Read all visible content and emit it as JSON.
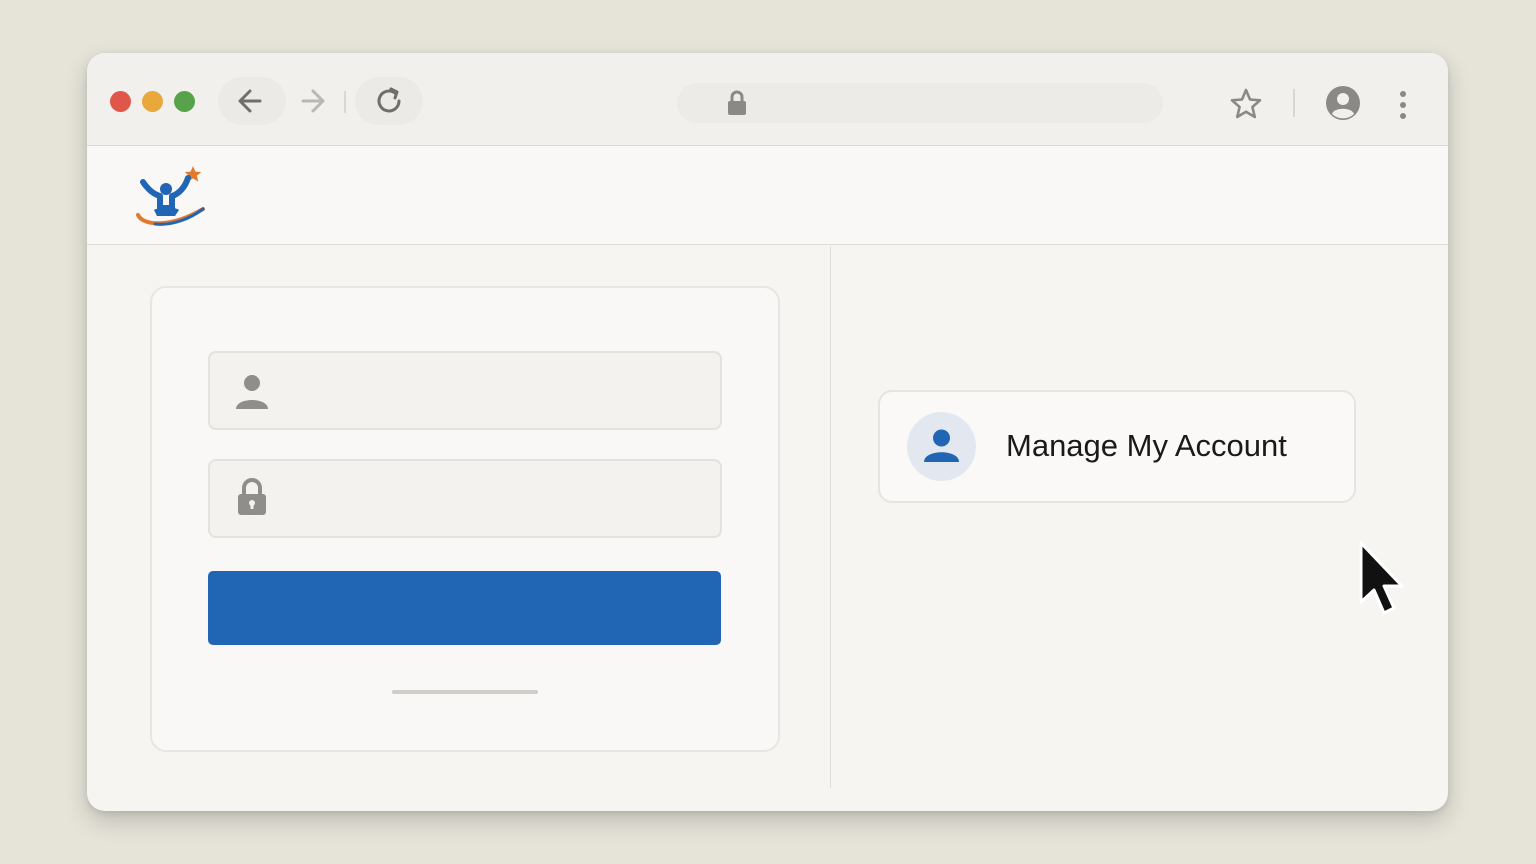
{
  "browser": {
    "traffic_lights": {
      "close_color": "#e0574a",
      "minimize_color": "#e8a93a",
      "maximize_color": "#57a34a"
    },
    "nav": {
      "back_icon": "arrow-left-icon",
      "forward_icon": "arrow-right-icon",
      "reload_icon": "reload-icon"
    },
    "address_bar": {
      "lock_icon": "lock-icon",
      "url": ""
    },
    "right_icons": [
      "star-icon",
      "profile-icon",
      "kebab-menu-icon"
    ]
  },
  "site": {
    "logo": {
      "icon": "person-star-logo",
      "colors": {
        "figure": "#2165b5",
        "swoosh": "#e07a2e",
        "star": "#e07a2e"
      }
    }
  },
  "login": {
    "username_icon": "user-icon",
    "username_value": "",
    "password_icon": "lock-icon",
    "password_value": "",
    "submit_label": "",
    "submit_color": "#2165b5"
  },
  "manage_account": {
    "icon": "user-icon",
    "label": "Manage My Account",
    "accent": "#2165b5"
  }
}
